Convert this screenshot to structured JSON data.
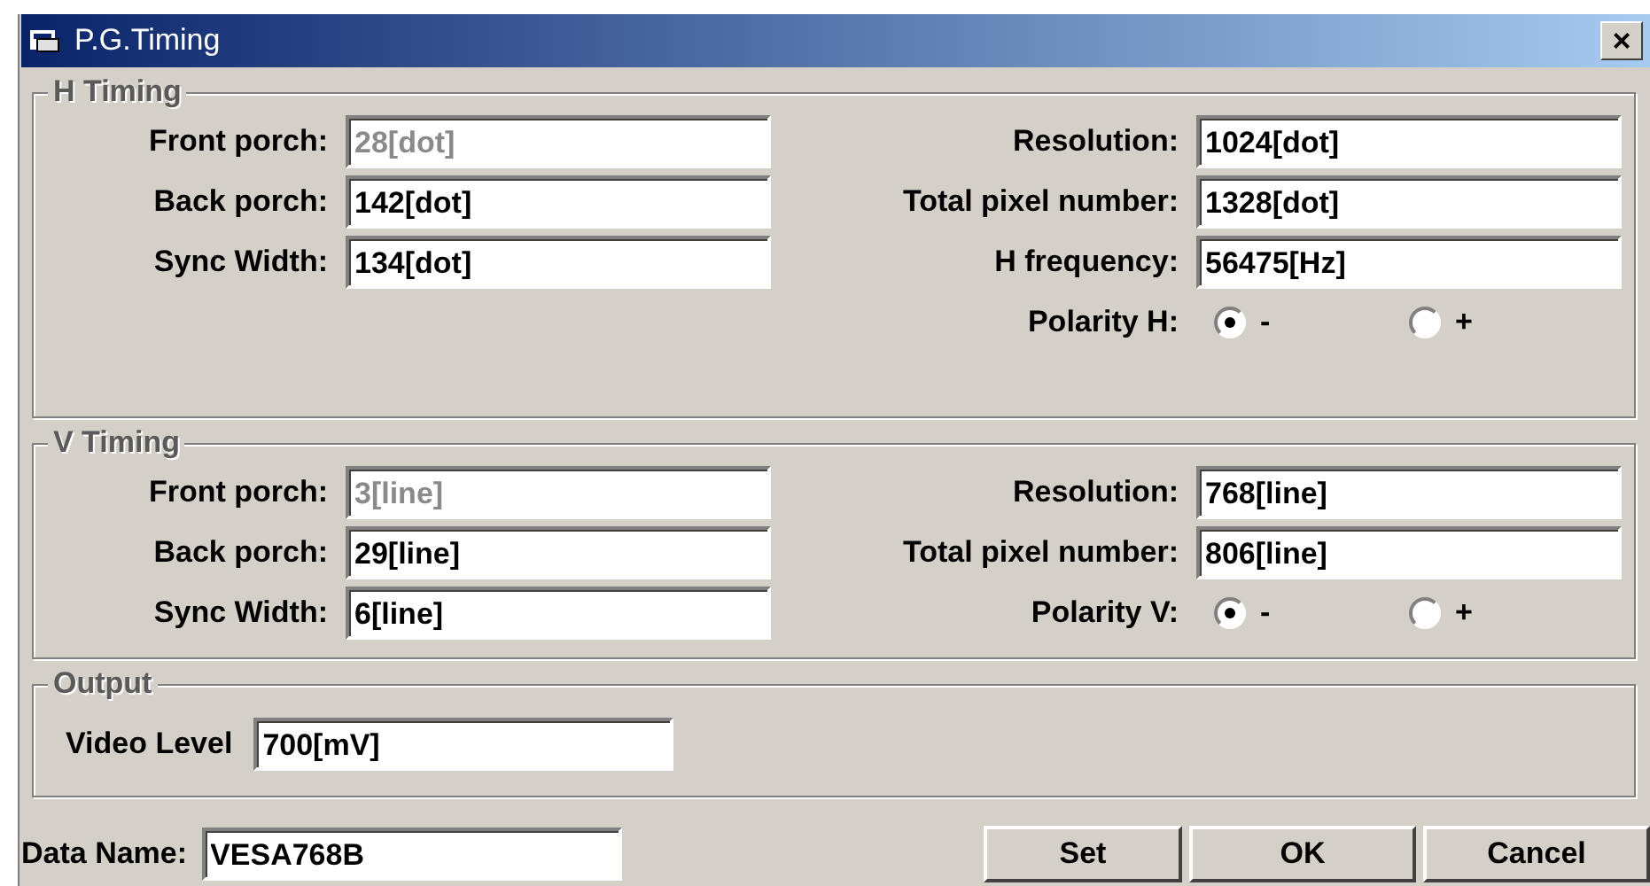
{
  "window": {
    "title": "P.G.Timing",
    "close": "×"
  },
  "groups": [
    {
      "title": "H Timing",
      "left": [
        {
          "label": "Front porch:",
          "value": "28[dot]",
          "disabled": true
        },
        {
          "label": "Back porch:",
          "value": "142[dot]",
          "disabled": false
        },
        {
          "label": "Sync Width:",
          "value": "134[dot]",
          "disabled": false
        }
      ],
      "right": [
        {
          "label": "Resolution:",
          "value": "1024[dot]",
          "disabled": false
        },
        {
          "label": "Total pixel number:",
          "value": "1328[dot]",
          "disabled": false
        },
        {
          "label": "H frequency:",
          "value": "56475[Hz]",
          "disabled": false
        }
      ],
      "polarity": {
        "label": "Polarity H:",
        "options": [
          {
            "label": "-",
            "selected": true
          },
          {
            "label": "+",
            "selected": false
          }
        ]
      }
    },
    {
      "title": "V Timing",
      "left": [
        {
          "label": "Front porch:",
          "value": "3[line]",
          "disabled": true
        },
        {
          "label": "Back porch:",
          "value": "29[line]",
          "disabled": false
        },
        {
          "label": "Sync Width:",
          "value": "6[line]",
          "disabled": false
        }
      ],
      "right": [
        {
          "label": "Resolution:",
          "value": "768[line]",
          "disabled": false
        },
        {
          "label": "Total pixel number:",
          "value": "806[line]",
          "disabled": false
        }
      ],
      "polarity": {
        "label": "Polarity V:",
        "options": [
          {
            "label": "-",
            "selected": true
          },
          {
            "label": "+",
            "selected": false
          }
        ]
      }
    }
  ],
  "output": {
    "title": "Output",
    "label": "Video Level",
    "value": "700[mV]"
  },
  "data_name": {
    "label": "Data Name:",
    "value": "VESA768B"
  },
  "buttons": [
    "Set",
    "OK",
    "Cancel"
  ]
}
